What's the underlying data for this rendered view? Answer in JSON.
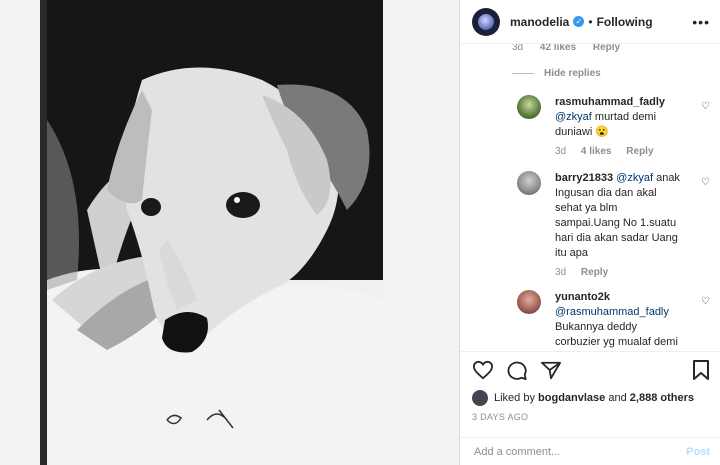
{
  "post": {
    "author": {
      "username": "manodelia",
      "verified_icon": "verified-badge-icon",
      "follow_status": "Following",
      "separator": "•"
    },
    "comments_feed": {
      "prev_meta": {
        "time": "3d",
        "likes": "42 likes",
        "reply": "Reply"
      },
      "hide_replies": "Hide replies",
      "comments": [
        {
          "username": "rasmuhammad_fadly",
          "mention": "",
          "text_mention": "@zkyaf",
          "text": "murtad demi duniawi",
          "emoji": "😮",
          "time": "3d",
          "likes": "4 likes",
          "reply": "Reply"
        },
        {
          "username": "barry21833",
          "text_mention": "@zkyaf",
          "text": "anak Ingusan dia dan akal sehat ya blm sampai.Uang No 1.suatu hari dia akan sadar Uang itu apa",
          "time": "3d",
          "reply": "Reply"
        },
        {
          "username": "yunanto2k",
          "text_mention": "@rasmuhammad_fadly",
          "text": "Bukannya deddy corbuzier yg mualaf demi"
        }
      ]
    },
    "likes_summary": {
      "prefix": "Liked by",
      "user": "bogdanvlase",
      "and": "and",
      "count": "2,888 others"
    },
    "posted_ago": "3 DAYS AGO",
    "add_comment": {
      "placeholder": "Add a comment...",
      "post_label": "Post"
    }
  },
  "colors": {
    "accent": "#3897f0",
    "link": "#00376b",
    "muted": "#8e8e8e",
    "text": "#262626",
    "post_disabled": "#b2dffc"
  }
}
